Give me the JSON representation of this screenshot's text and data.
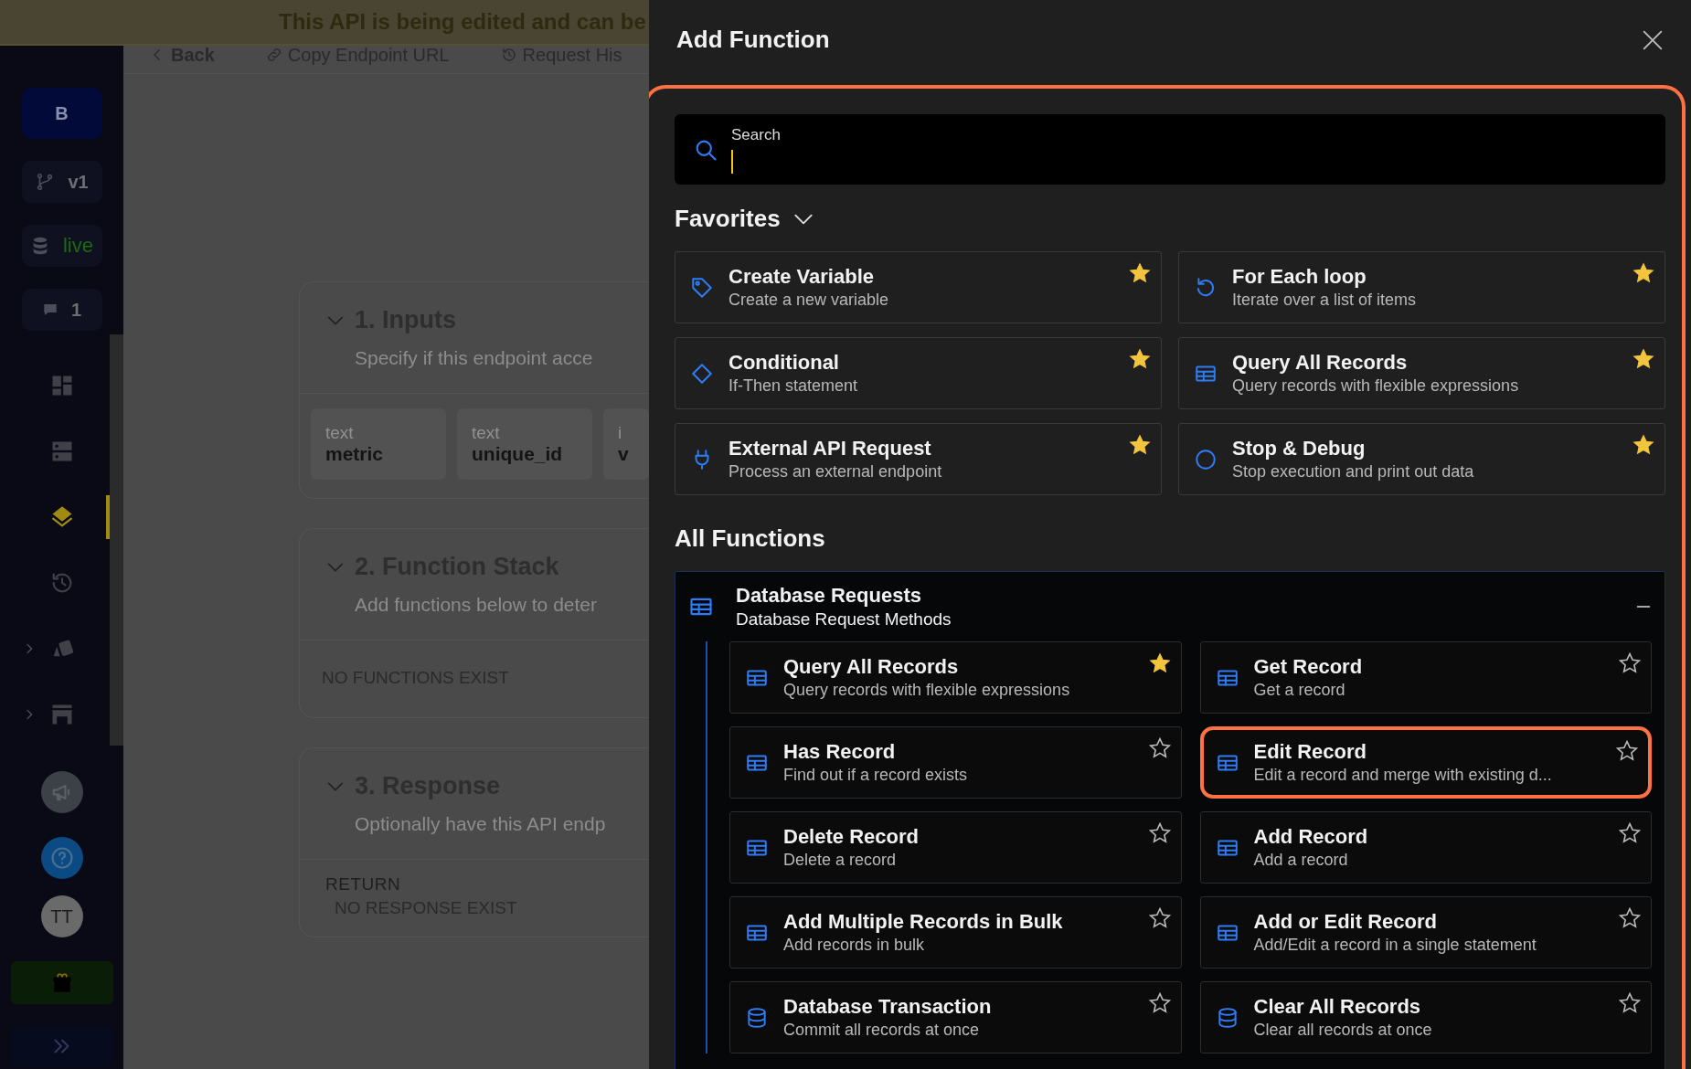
{
  "banner": {
    "text": "This API is being edited and can be"
  },
  "sidebar": {
    "top": [
      {
        "kind": "badge",
        "label": "B"
      },
      {
        "kind": "branch",
        "label": "v1"
      },
      {
        "kind": "datasource",
        "label": "live"
      },
      {
        "kind": "comments",
        "label": "1"
      }
    ],
    "nav": [
      {
        "kind": "dashboard",
        "selected": false,
        "expandable": false
      },
      {
        "kind": "server",
        "selected": false,
        "expandable": false
      },
      {
        "kind": "api",
        "selected": true,
        "expandable": false
      },
      {
        "kind": "history",
        "selected": false,
        "expandable": false
      },
      {
        "kind": "addons",
        "selected": false,
        "expandable": true
      },
      {
        "kind": "store",
        "selected": false,
        "expandable": true
      }
    ],
    "avatar": "TT"
  },
  "toolbar": [
    {
      "kind": "back",
      "label": "Back"
    },
    {
      "kind": "link",
      "label": "Copy Endpoint URL"
    },
    {
      "kind": "history",
      "label": "Request His"
    }
  ],
  "sections": [
    {
      "title": "1. Inputs",
      "description": "Specify if this endpoint acce",
      "inputs": [
        {
          "type": "text",
          "name": "metric"
        },
        {
          "type": "text",
          "name": "unique_id"
        },
        {
          "type": "i",
          "name": "v"
        }
      ]
    },
    {
      "title": "2. Function Stack",
      "description": "Add functions below to deter",
      "empty": "NO FUNCTIONS EXIST"
    },
    {
      "title": "3. Response",
      "description": "Optionally have this API endp",
      "label": "RETURN",
      "empty": "NO RESPONSE EXIST"
    }
  ],
  "panel": {
    "title": "Add Function",
    "highlighted": true,
    "search": {
      "label": "Search"
    },
    "favorites": {
      "title": "Favorites",
      "expanded": true,
      "items": [
        {
          "kind": "tag",
          "title": "Create Variable",
          "description": "Create a new variable",
          "starred": true
        },
        {
          "kind": "loop",
          "title": "For Each loop",
          "description": "Iterate over a list of items",
          "starred": true
        },
        {
          "kind": "diamond",
          "title": "Conditional",
          "description": "If-Then statement",
          "starred": true
        },
        {
          "kind": "table",
          "title": "Query All Records",
          "description": "Query records with flexible expressions",
          "starred": true
        },
        {
          "kind": "plug",
          "title": "External API Request",
          "description": "Process an external endpoint",
          "starred": true
        },
        {
          "kind": "octagon",
          "title": "Stop & Debug",
          "description": "Stop execution and print out data",
          "starred": true
        }
      ]
    },
    "all_functions": {
      "title": "All Functions",
      "groups": [
        {
          "kind": "table",
          "title": "Database Requests",
          "subtitle": "Database Request Methods",
          "expanded": true,
          "items": [
            {
              "kind": "table",
              "title": "Query All Records",
              "description": "Query records with flexible expressions",
              "starred": true,
              "highlighted": false
            },
            {
              "kind": "table",
              "title": "Get Record",
              "description": "Get a record",
              "starred": false,
              "highlighted": false
            },
            {
              "kind": "table",
              "title": "Has Record",
              "description": "Find out if a record exists",
              "starred": false,
              "highlighted": false
            },
            {
              "kind": "table",
              "title": "Edit Record",
              "description": "Edit a record and merge with existing d...",
              "starred": false,
              "highlighted": true
            },
            {
              "kind": "table",
              "title": "Delete Record",
              "description": "Delete a record",
              "starred": false,
              "highlighted": false
            },
            {
              "kind": "table",
              "title": "Add Record",
              "description": "Add a record",
              "starred": false,
              "highlighted": false
            },
            {
              "kind": "table",
              "title": "Add Multiple Records in Bulk",
              "description": "Add records in bulk",
              "starred": false,
              "highlighted": false
            },
            {
              "kind": "table",
              "title": "Add or Edit Record",
              "description": "Add/Edit a record in a single statement",
              "starred": false,
              "highlighted": false
            },
            {
              "kind": "database",
              "title": "Database Transaction",
              "description": "Commit all records at once",
              "starred": false,
              "highlighted": false
            },
            {
              "kind": "database",
              "title": "Clear All Records",
              "description": "Clear all records at once",
              "starred": false,
              "highlighted": false
            }
          ]
        }
      ]
    }
  }
}
